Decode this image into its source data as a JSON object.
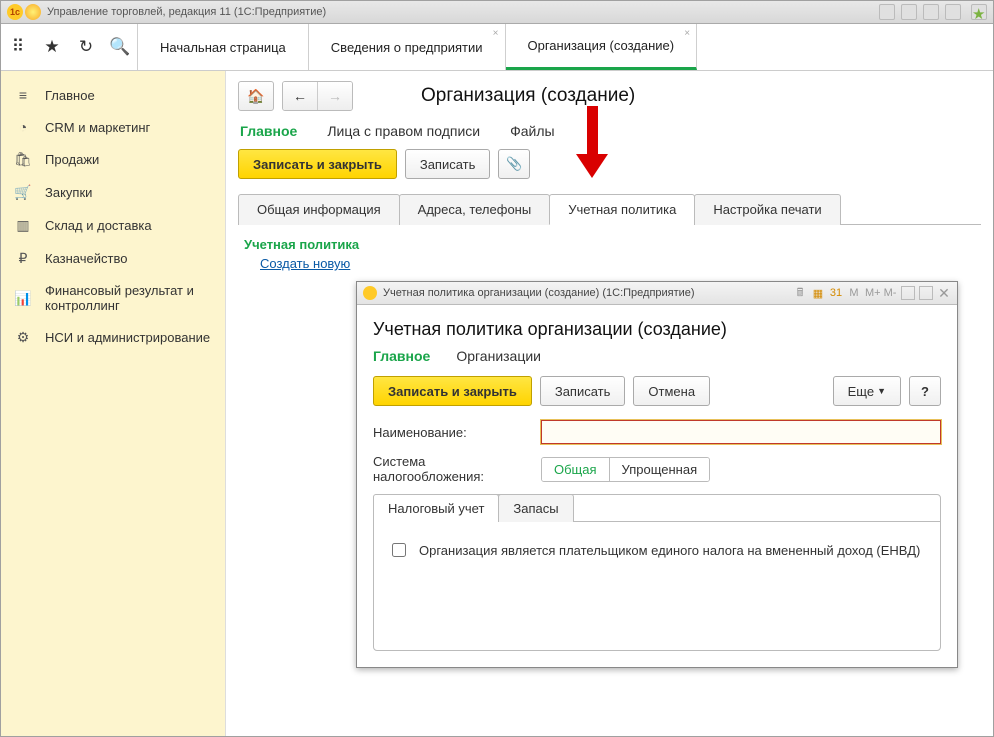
{
  "titlebar": {
    "title": "Управление торговлей, редакция 11  (1С:Предприятие)"
  },
  "toolbar": {
    "tabs": [
      {
        "label": "Начальная страница"
      },
      {
        "label": "Сведения о предприятии"
      },
      {
        "label": "Организация (создание)"
      }
    ]
  },
  "sidebar": {
    "items": [
      {
        "label": "Главное",
        "icon": "≡"
      },
      {
        "label": "CRM и маркетинг",
        "icon": "◔"
      },
      {
        "label": "Продажи",
        "icon": "🛍"
      },
      {
        "label": "Закупки",
        "icon": "🛒"
      },
      {
        "label": "Склад и доставка",
        "icon": "▥"
      },
      {
        "label": "Казначейство",
        "icon": "₽"
      },
      {
        "label": "Финансовый результат и контроллинг",
        "icon": "📊"
      },
      {
        "label": "НСИ и администрирование",
        "icon": "⚙"
      }
    ]
  },
  "page": {
    "title": "Организация (создание)",
    "subnav": [
      {
        "label": "Главное"
      },
      {
        "label": "Лица с правом подписи"
      },
      {
        "label": "Файлы"
      }
    ],
    "buttons": {
      "save_close": "Записать и закрыть",
      "save": "Записать"
    },
    "doc_tabs": [
      {
        "label": "Общая информация"
      },
      {
        "label": "Адреса, телефоны"
      },
      {
        "label": "Учетная политика"
      },
      {
        "label": "Настройка печати"
      }
    ],
    "section_title": "Учетная политика",
    "create_link": "Создать новую"
  },
  "modal": {
    "titlebar": "Учетная политика организации (создание)  (1С:Предприятие)",
    "mem": [
      "M",
      "M+",
      "M-"
    ],
    "heading": "Учетная политика организации (создание)",
    "subnav": [
      {
        "label": "Главное"
      },
      {
        "label": "Организации"
      }
    ],
    "buttons": {
      "save_close": "Записать и закрыть",
      "save": "Записать",
      "cancel": "Отмена",
      "more": "Еще",
      "help": "?"
    },
    "labels": {
      "name": "Наименование:",
      "tax": "Система налогообложения:"
    },
    "tax_options": [
      "Общая",
      "Упрощенная"
    ],
    "inner_tabs": [
      "Налоговый учет",
      "Запасы"
    ],
    "checkbox": "Организация является плательщиком единого налога на вмененный доход (ЕНВД)"
  }
}
